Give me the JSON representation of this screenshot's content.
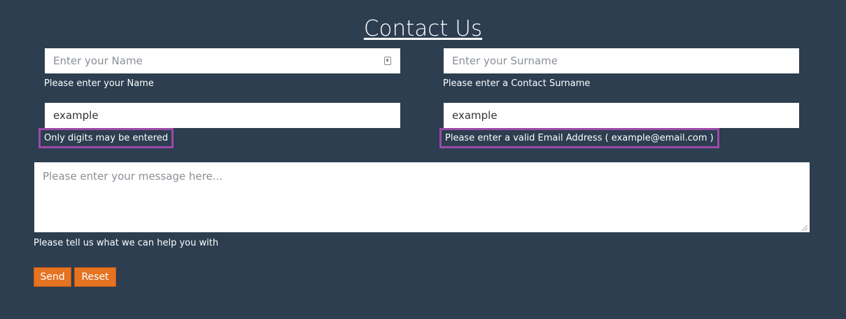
{
  "page": {
    "title": "Contact Us"
  },
  "form": {
    "name": {
      "placeholder": "Enter your Name",
      "value": "",
      "hint": "Please enter your Name"
    },
    "surname": {
      "placeholder": "Enter your Surname",
      "value": "",
      "hint": "Please enter a Contact Surname"
    },
    "phone": {
      "value": "example",
      "error": "Only digits may be entered"
    },
    "email": {
      "value": "example",
      "error": "Please enter a valid Email Address ( example@email.com )"
    },
    "message": {
      "placeholder": "Please enter your message here...",
      "hint": "Please tell us what we can help you with"
    },
    "buttons": {
      "send": "Send",
      "reset": "Reset"
    }
  },
  "colors": {
    "background": "#2c3e50",
    "button": "#e67322",
    "error_border": "#9b4aa8"
  },
  "icons": {
    "name_field": "contact-card-icon",
    "textarea": "resize-grip-icon"
  }
}
